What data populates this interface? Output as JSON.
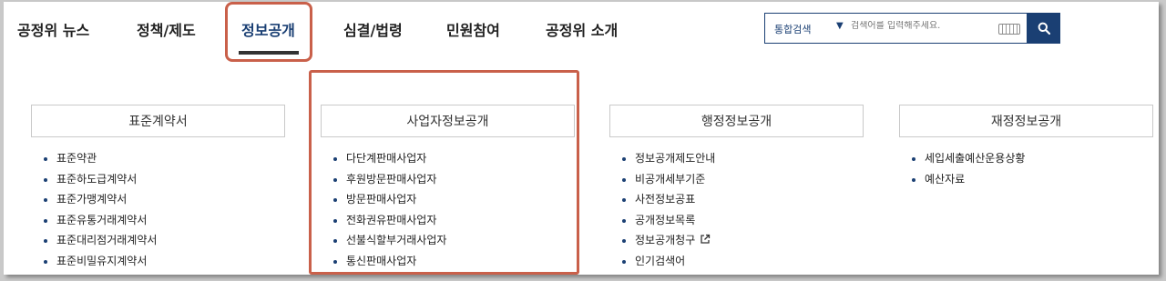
{
  "nav": {
    "items": [
      "공정위 뉴스",
      "정책/제도",
      "정보공개",
      "심결/법령",
      "민원참여",
      "공정위 소개"
    ],
    "active_index": 2
  },
  "search": {
    "scope": "통합검색",
    "placeholder": "검색어를 입력해주세요."
  },
  "columns": [
    {
      "title": "표준계약서",
      "items": [
        "표준약관",
        "표준하도급계약서",
        "표준가맹계약서",
        "표준유통거래계약서",
        "표준대리점거래계약서",
        "표준비밀유지계약서"
      ]
    },
    {
      "title": "사업자정보공개",
      "items": [
        "다단계판매사업자",
        "후원방문판매사업자",
        "방문판매사업자",
        "전화권유판매사업자",
        "선불식할부거래사업자",
        "통신판매사업자"
      ]
    },
    {
      "title": "행정정보공개",
      "items": [
        "정보공개제도안내",
        "비공개세부기준",
        "사전정보공표",
        "공개정보목록",
        "정보공개청구",
        "인기검색어"
      ]
    },
    {
      "title": "재정정보공개",
      "items": [
        "세입세출예산운용상황",
        "예산자료"
      ]
    }
  ],
  "colors": {
    "primary": "#1a3f73",
    "highlight": "#c9604a"
  }
}
